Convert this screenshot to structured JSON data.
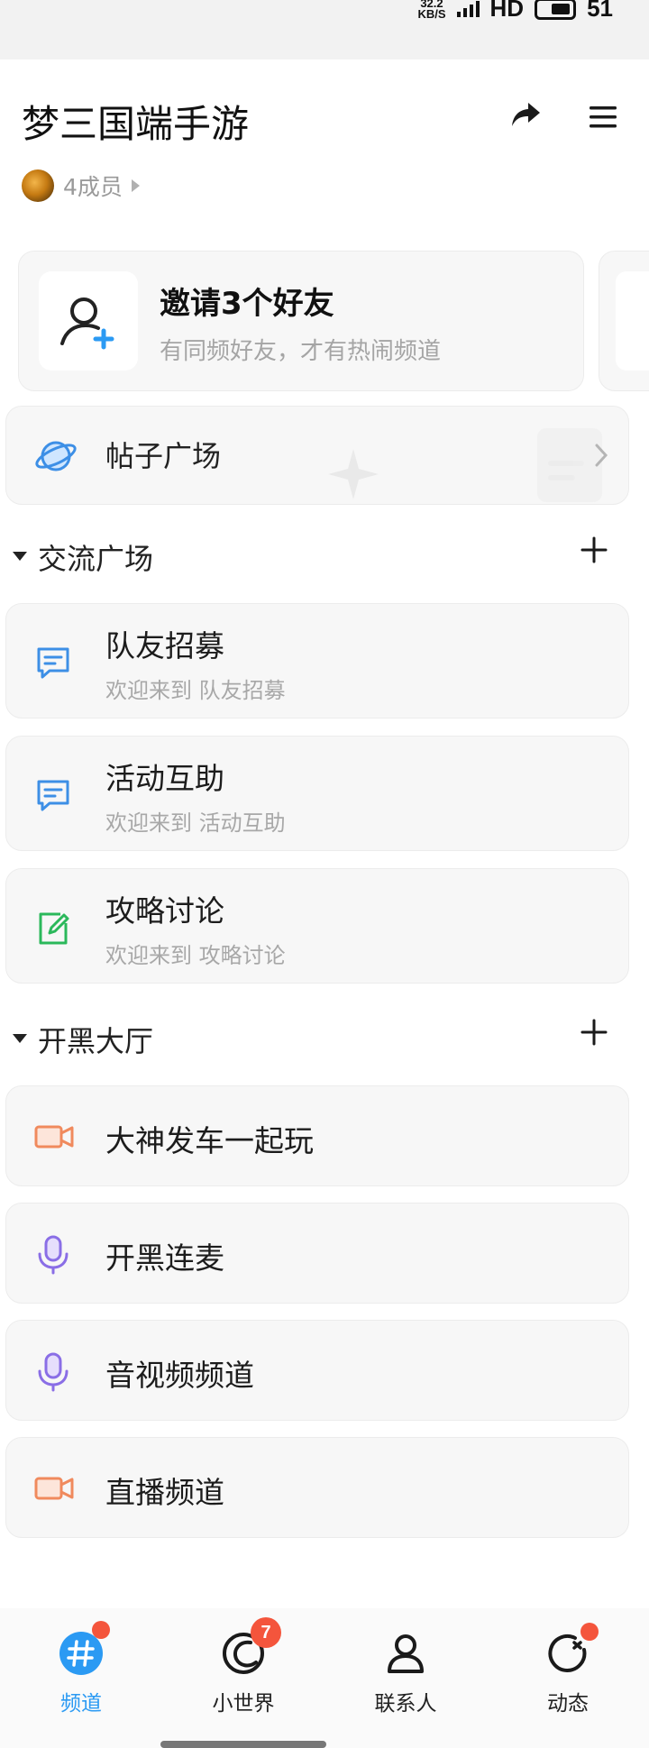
{
  "status_bar": {
    "speed_value": "32.2",
    "speed_unit": "KB/S",
    "network": "HD",
    "battery": "51"
  },
  "header": {
    "title": "梦三国端手游",
    "members_label": "4成员"
  },
  "invite": {
    "title": "邀请3个好友",
    "subtitle": "有同频好友，才有热闹频道"
  },
  "post_square": {
    "label": "帖子广场"
  },
  "sections": [
    {
      "name": "交流广场",
      "channels": [
        {
          "name": "队友招募",
          "subtitle": "欢迎来到 队友招募",
          "icon": "chat-bubble-icon",
          "color": "#3d8fe6"
        },
        {
          "name": "活动互助",
          "subtitle": "欢迎来到 活动互助",
          "icon": "chat-bubble-icon",
          "color": "#3d8fe6"
        },
        {
          "name": "攻略讨论",
          "subtitle": "欢迎来到 攻略讨论",
          "icon": "edit-note-icon",
          "color": "#2bb85b"
        }
      ]
    },
    {
      "name": "开黑大厅",
      "channels": [
        {
          "name": "大神发车一起玩",
          "icon": "video-camera-icon",
          "color": "#f08a5d"
        },
        {
          "name": "开黑连麦",
          "icon": "microphone-icon",
          "color": "#8a6ee6"
        },
        {
          "name": "音视频频道",
          "icon": "microphone-icon",
          "color": "#8a6ee6"
        },
        {
          "name": "直播频道",
          "icon": "video-camera-icon",
          "color": "#f08a5d"
        }
      ]
    }
  ],
  "tabbar": {
    "tabs": [
      {
        "label": "频道",
        "icon": "channel-hash-icon",
        "active": true,
        "badge": "dot"
      },
      {
        "label": "小世界",
        "icon": "small-world-icon",
        "active": false,
        "badge": "7"
      },
      {
        "label": "联系人",
        "icon": "contacts-icon",
        "active": false,
        "badge": ""
      },
      {
        "label": "动态",
        "icon": "activity-icon",
        "active": false,
        "badge": "dot"
      }
    ]
  },
  "colors": {
    "accent": "#2b9af3",
    "badge": "#f4553c",
    "card_bg": "#f7f7f7"
  }
}
